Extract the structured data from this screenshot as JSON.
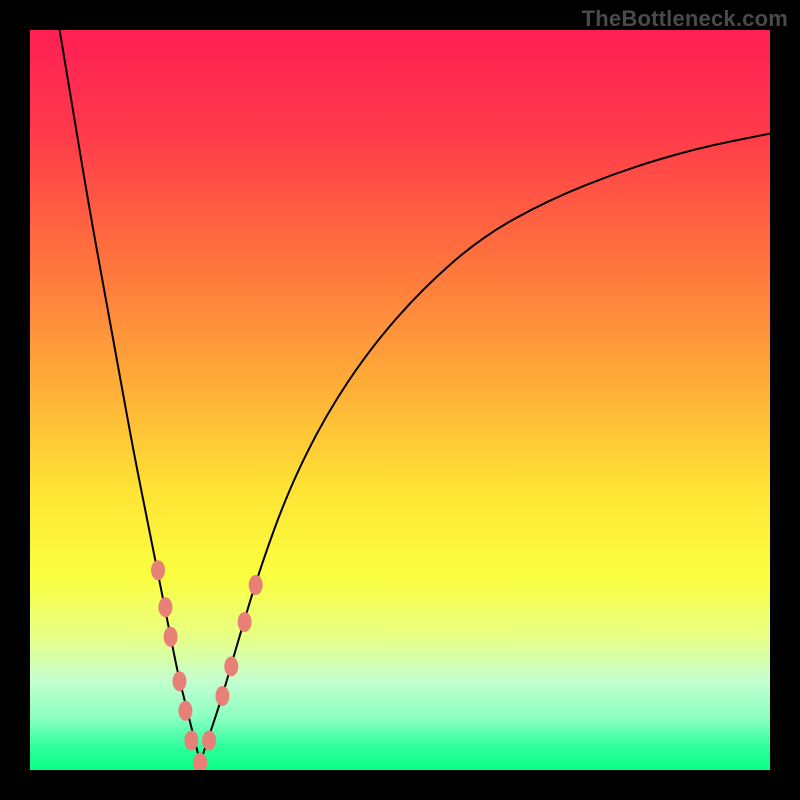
{
  "watermark": "TheBottleneck.com",
  "chart_data": {
    "type": "line",
    "title": "",
    "xlabel": "",
    "ylabel": "",
    "xlim": [
      0,
      100
    ],
    "ylim": [
      0,
      100
    ],
    "grid": false,
    "legend": false,
    "gradient_stops": [
      {
        "pct": 0,
        "color": "#ff1f54"
      },
      {
        "pct": 14,
        "color": "#ff3a4a"
      },
      {
        "pct": 30,
        "color": "#ff6f3e"
      },
      {
        "pct": 48,
        "color": "#ffad38"
      },
      {
        "pct": 62,
        "color": "#ffe334"
      },
      {
        "pct": 74,
        "color": "#fbff41"
      },
      {
        "pct": 82,
        "color": "#e8ff85"
      },
      {
        "pct": 88,
        "color": "#c4ffd0"
      },
      {
        "pct": 93,
        "color": "#8affc0"
      },
      {
        "pct": 97,
        "color": "#2cff9c"
      },
      {
        "pct": 100,
        "color": "#0aff84"
      }
    ],
    "series": [
      {
        "name": "left-branch",
        "color": "#000000",
        "stroke_width": 2,
        "x": [
          4,
          6,
          8,
          10,
          12,
          14,
          16,
          18,
          19,
          20,
          21,
          22,
          23
        ],
        "y": [
          100,
          88,
          76,
          65,
          54,
          43,
          33,
          23,
          18,
          13,
          9,
          5,
          1
        ]
      },
      {
        "name": "right-branch",
        "color": "#000000",
        "stroke_width": 2,
        "x": [
          23,
          24,
          26,
          28,
          31,
          35,
          40,
          46,
          53,
          61,
          70,
          80,
          90,
          100
        ],
        "y": [
          1,
          4,
          10,
          17,
          27,
          38,
          48,
          57,
          65,
          72,
          77,
          81,
          84,
          86
        ]
      }
    ],
    "markers": {
      "name": "highlight-points",
      "color": "#e78178",
      "rx": 7,
      "ry": 10,
      "points": [
        {
          "x": 17.3,
          "y": 27
        },
        {
          "x": 18.3,
          "y": 22
        },
        {
          "x": 19.0,
          "y": 18
        },
        {
          "x": 20.2,
          "y": 12
        },
        {
          "x": 21.0,
          "y": 8
        },
        {
          "x": 21.8,
          "y": 4
        },
        {
          "x": 23.0,
          "y": 1
        },
        {
          "x": 24.2,
          "y": 4
        },
        {
          "x": 26.0,
          "y": 10
        },
        {
          "x": 27.2,
          "y": 14
        },
        {
          "x": 29.0,
          "y": 20
        },
        {
          "x": 30.5,
          "y": 25
        }
      ]
    }
  }
}
